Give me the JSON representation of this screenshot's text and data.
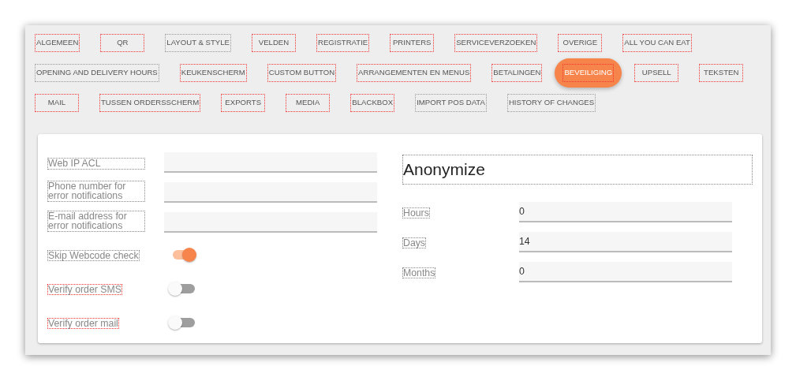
{
  "tabs": [
    {
      "label": "ALGEMEEN",
      "selected": false,
      "flagged": true
    },
    {
      "label": "QR",
      "selected": false,
      "flagged": true
    },
    {
      "label": "LAYOUT & STYLE",
      "selected": false,
      "flagged": false
    },
    {
      "label": "VELDEN",
      "selected": false,
      "flagged": true
    },
    {
      "label": "REGISTRATIE",
      "selected": false,
      "flagged": true
    },
    {
      "label": "PRINTERS",
      "selected": false,
      "flagged": true
    },
    {
      "label": "SERVICEVERZOEKEN",
      "selected": false,
      "flagged": true
    },
    {
      "label": "OVERIGE",
      "selected": false,
      "flagged": true
    },
    {
      "label": "ALL YOU CAN EAT",
      "selected": false,
      "flagged": true
    },
    {
      "label": "OPENING AND DELIVERY HOURS",
      "selected": false,
      "flagged": false
    },
    {
      "label": "KEUKENSCHERM",
      "selected": false,
      "flagged": true
    },
    {
      "label": "CUSTOM BUTTON",
      "selected": false,
      "flagged": true
    },
    {
      "label": "ARRANGEMENTEN EN MENUS",
      "selected": false,
      "flagged": true
    },
    {
      "label": "BETALINGEN",
      "selected": false,
      "flagged": true
    },
    {
      "label": "BEVEILIGING",
      "selected": true,
      "flagged": true
    },
    {
      "label": "UPSELL",
      "selected": false,
      "flagged": true
    },
    {
      "label": "TEKSTEN",
      "selected": false,
      "flagged": true
    },
    {
      "label": "MAIL",
      "selected": false,
      "flagged": true
    },
    {
      "label": "TUSSEN ORDERSSCHERM",
      "selected": false,
      "flagged": true
    },
    {
      "label": "EXPORTS",
      "selected": false,
      "flagged": true
    },
    {
      "label": "MEDIA",
      "selected": false,
      "flagged": true
    },
    {
      "label": "BLACKBOX",
      "selected": false,
      "flagged": true
    },
    {
      "label": "IMPORT POS DATA",
      "selected": false,
      "flagged": false
    },
    {
      "label": "HISTORY OF CHANGES",
      "selected": false,
      "flagged": false
    }
  ],
  "settings": [
    {
      "kind": "text",
      "label": "Web IP ACL",
      "flagged": false
    },
    {
      "kind": "text",
      "label": "Phone number for error notifications",
      "flagged": false
    },
    {
      "kind": "text",
      "label": "E-mail address for error notifications",
      "flagged": false
    },
    {
      "kind": "switch",
      "label": "Skip Webcode check",
      "flagged": false,
      "on": true
    },
    {
      "kind": "switch",
      "label": "Verify order SMS",
      "flagged": true,
      "on": false
    },
    {
      "kind": "switch",
      "label": "Verify order mail",
      "flagged": true,
      "on": false
    }
  ],
  "anonymize": {
    "title": "Anonymize",
    "fields": [
      {
        "label": "Hours",
        "value": "0"
      },
      {
        "label": "Days",
        "value": "14"
      },
      {
        "label": "Months",
        "value": "0"
      }
    ]
  }
}
